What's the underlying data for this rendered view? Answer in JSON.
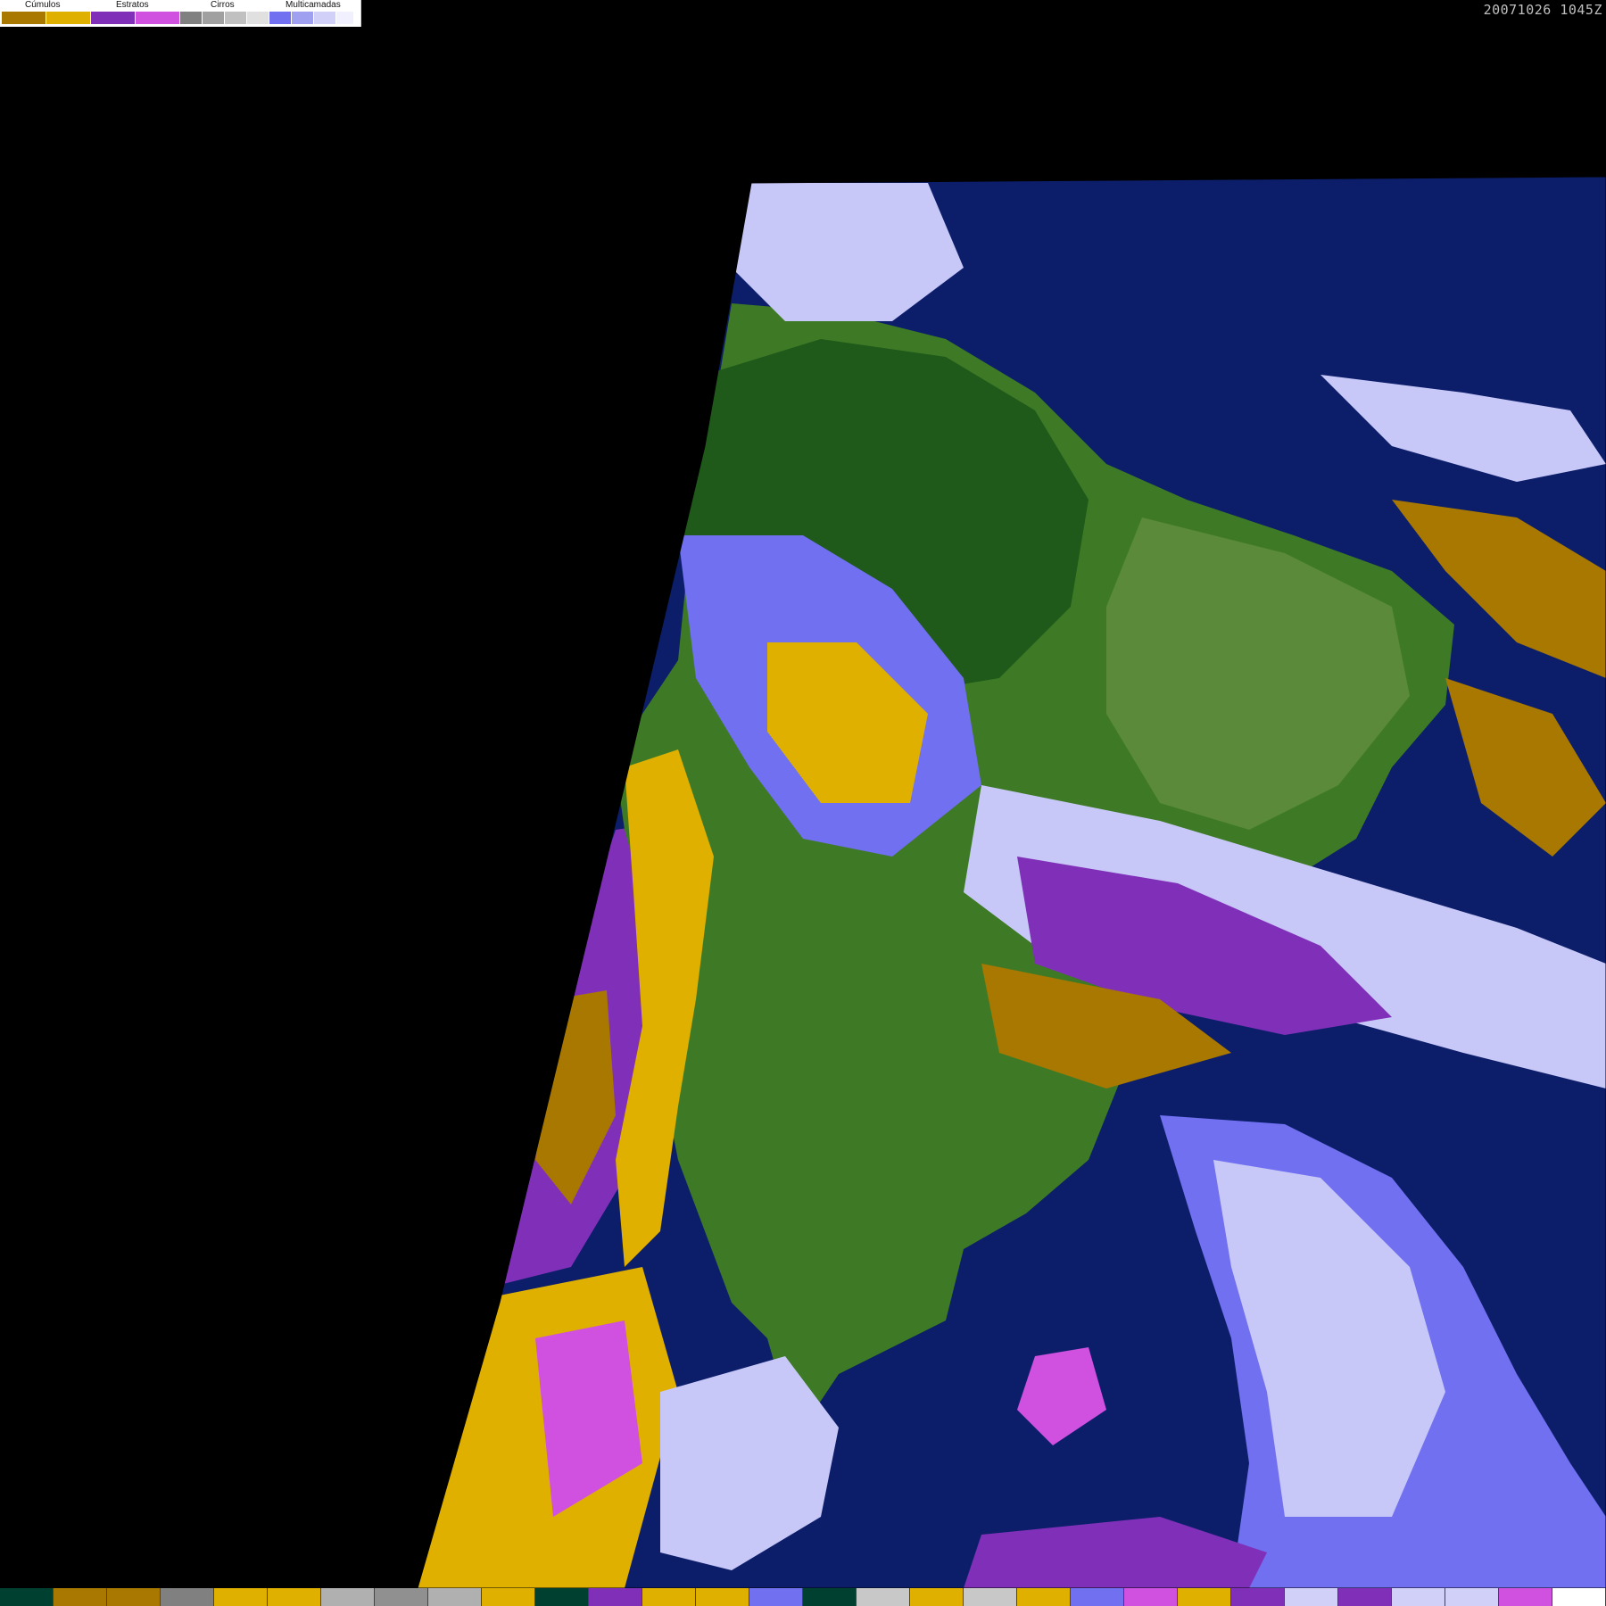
{
  "header": {
    "timestamp": "20071026 1045Z"
  },
  "legend": {
    "categories": [
      {
        "label": "Cúmulos",
        "colors": [
          "#a87800",
          "#e0b000"
        ]
      },
      {
        "label": "Estratos",
        "colors": [
          "#8030b8",
          "#d050e0"
        ]
      },
      {
        "label": "Cirros",
        "colors": [
          "#808080",
          "#a0a0a0",
          "#c0c0c0",
          "#e0e0e0"
        ]
      },
      {
        "label": "Multicamadas",
        "colors": [
          "#7070f0",
          "#a0a0f0",
          "#d0d0f8",
          "#f0f0ff"
        ]
      }
    ]
  },
  "map": {
    "colors": {
      "background": "#000000",
      "ocean": "#0c1e6a",
      "land_dark": "#1f5a1a",
      "land": "#3e7a26",
      "land_light": "#5a8a3a",
      "stratus": "#8030b8",
      "stratus_light": "#d050e0",
      "cumulus": "#a87800",
      "cumulus_light": "#e0b000",
      "multi": "#7070f0",
      "multi_light": "#c8c8f8",
      "cirrus": "#b0b0b0"
    }
  },
  "bottom_bar": {
    "colors": [
      "#004030",
      "#a87800",
      "#a87800",
      "#808080",
      "#e0b000",
      "#e0b000",
      "#b0b0b0",
      "#909090",
      "#b0b0b0",
      "#e0b000",
      "#004030",
      "#8030b8",
      "#e0b000",
      "#e0b000",
      "#7070f0",
      "#004030",
      "#c8c8c8",
      "#e0b000",
      "#c8c8c8",
      "#e0b000",
      "#7070f0",
      "#d050e0",
      "#e0b000",
      "#8030b8",
      "#d0d0f8",
      "#8030b8",
      "#d0d0f8",
      "#d0d0f8",
      "#d050e0",
      "#ffffff"
    ]
  }
}
